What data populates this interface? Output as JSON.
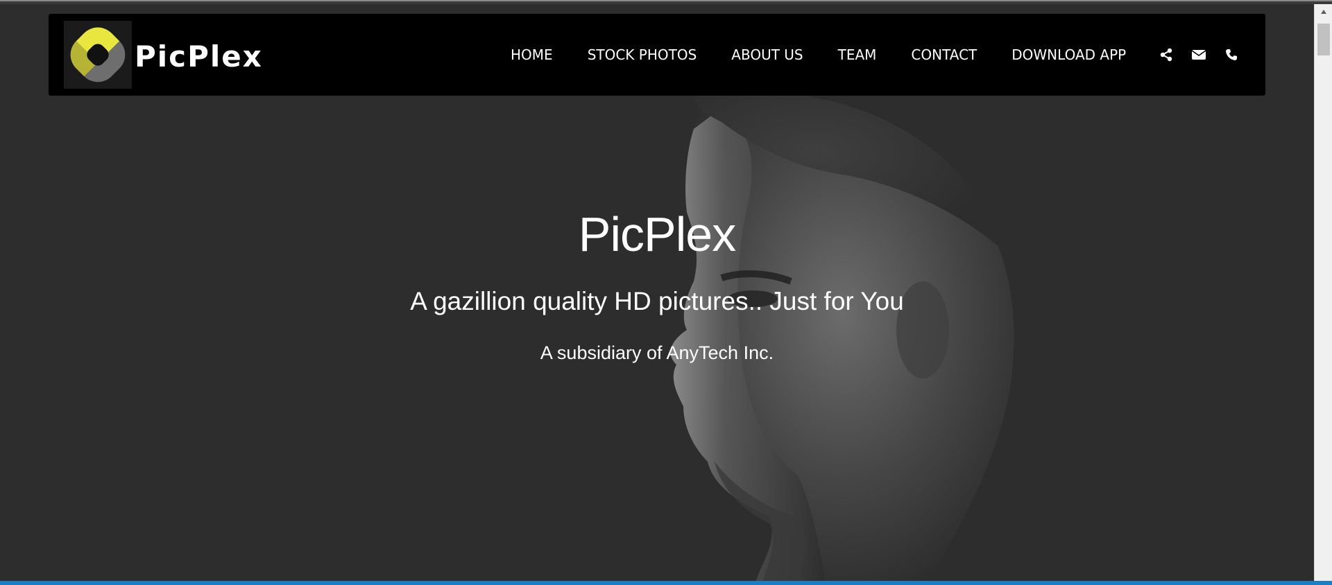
{
  "brand": {
    "name": "PicPlex",
    "logo_colors": {
      "yellow": "#e9e640",
      "olive": "#b6b335",
      "gray": "#6e6e6e",
      "dark": "#111111"
    }
  },
  "nav": {
    "links": [
      {
        "label": "HOME"
      },
      {
        "label": "STOCK PHOTOS"
      },
      {
        "label": "ABOUT US"
      },
      {
        "label": "TEAM"
      },
      {
        "label": "CONTACT"
      },
      {
        "label": "DOWNLOAD APP"
      }
    ],
    "icons": [
      "share-icon",
      "envelope-icon",
      "phone-icon"
    ]
  },
  "hero": {
    "title": "PicPlex",
    "subtitle": "A gazillion quality HD pictures.. Just for You",
    "note": "A subsidiary of AnyTech Inc.",
    "background": "#2d2d2d"
  },
  "colors": {
    "navbar_bg": "#000000",
    "text": "#ffffff",
    "accent_bottom": "#1c7dc4"
  }
}
